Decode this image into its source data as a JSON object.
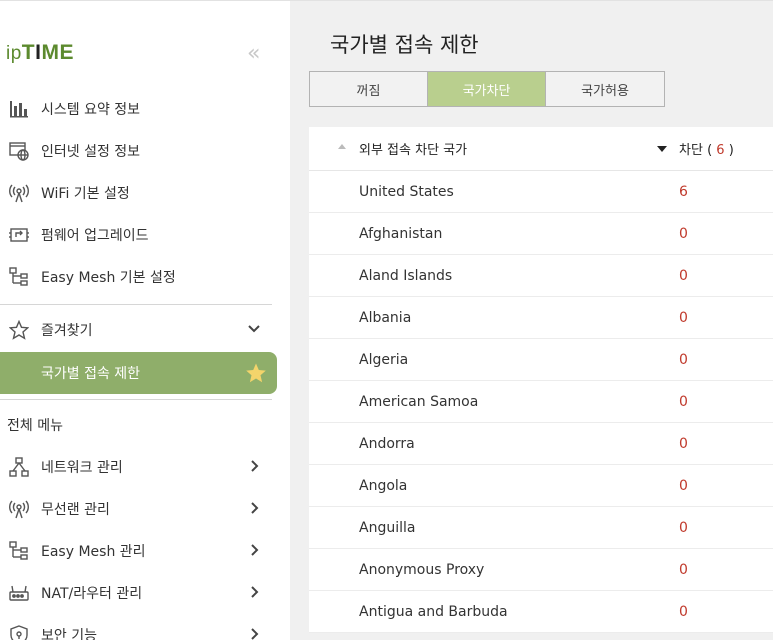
{
  "logo": {
    "ip": "ip",
    "time_pre": "T",
    "time_mid": "I",
    "time_post": "ME"
  },
  "sidebar": {
    "collapse_glyph": "«",
    "top_items": [
      {
        "label": "시스템 요약 정보",
        "icon": "bar-chart-icon"
      },
      {
        "label": "인터넷 설정 정보",
        "icon": "globe-window-icon"
      },
      {
        "label": "WiFi 기본 설정",
        "icon": "wifi-antenna-icon"
      },
      {
        "label": "펌웨어 업그레이드",
        "icon": "firmware-chip-icon"
      },
      {
        "label": "Easy Mesh 기본 설정",
        "icon": "mesh-tree-icon"
      }
    ],
    "favorites": {
      "label": "즐겨찾기",
      "icon": "star-outline-icon",
      "chevron": "chevron-down-icon"
    },
    "favorite_active": {
      "label": "국가별 접속 제한",
      "icon": "star-filled-icon",
      "star_color": "#f3d46b"
    },
    "all_menu_label": "전체 메뉴",
    "all_items": [
      {
        "label": "네트워크 관리",
        "icon": "network-icon"
      },
      {
        "label": "무선랜 관리",
        "icon": "wifi-antenna-icon"
      },
      {
        "label": "Easy Mesh 관리",
        "icon": "mesh-tree-icon"
      },
      {
        "label": "NAT/라우터 관리",
        "icon": "router-icon"
      },
      {
        "label": "보안 기능",
        "icon": "shield-lock-icon"
      }
    ]
  },
  "main": {
    "title": "국가별 접속 제한",
    "tabs": [
      {
        "label": "꺼짐",
        "active": false
      },
      {
        "label": "국가차단",
        "active": true
      },
      {
        "label": "국가허용",
        "active": false
      }
    ],
    "table": {
      "col1_header": "외부 접속 차단 국가",
      "col2_header": "차단",
      "col2_paren_open": "( ",
      "col2_count": "6",
      "col2_paren_close": " )",
      "rows": [
        {
          "name": "United States",
          "value": "6"
        },
        {
          "name": "Afghanistan",
          "value": "0"
        },
        {
          "name": "Aland Islands",
          "value": "0"
        },
        {
          "name": "Albania",
          "value": "0"
        },
        {
          "name": "Algeria",
          "value": "0"
        },
        {
          "name": "American Samoa",
          "value": "0"
        },
        {
          "name": "Andorra",
          "value": "0"
        },
        {
          "name": "Angola",
          "value": "0"
        },
        {
          "name": "Anguilla",
          "value": "0"
        },
        {
          "name": "Anonymous Proxy",
          "value": "0"
        },
        {
          "name": "Antigua and Barbuda",
          "value": "0"
        }
      ]
    }
  },
  "colors": {
    "accent_green": "#8fae6a",
    "tab_active": "#b9cf8e",
    "count_red": "#c0392b",
    "logo_green": "#5c8a2e"
  }
}
